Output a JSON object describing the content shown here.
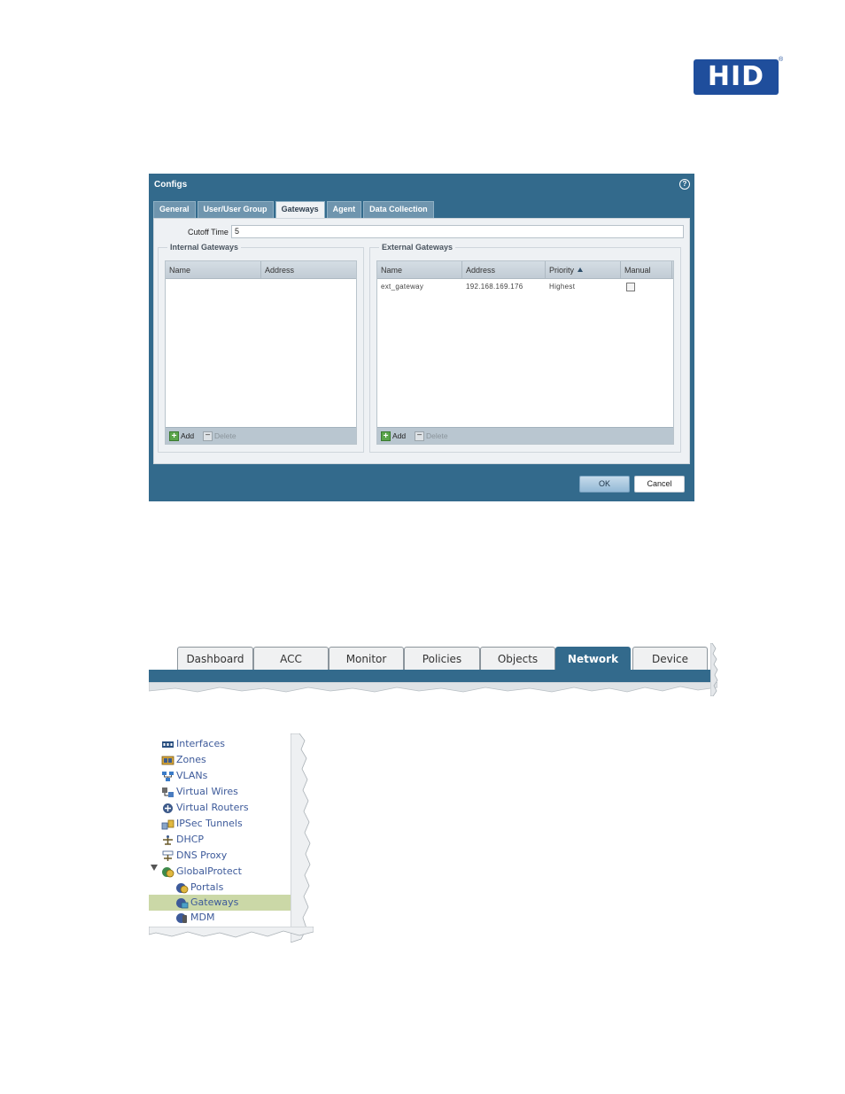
{
  "logo": {
    "text": "HID",
    "registered": "®"
  },
  "dialog": {
    "title": "Configs",
    "tabs": [
      {
        "label": "General",
        "active": false
      },
      {
        "label": "User/User Group",
        "active": false
      },
      {
        "label": "Gateways",
        "active": true
      },
      {
        "label": "Agent",
        "active": false
      },
      {
        "label": "Data Collection",
        "active": false
      }
    ],
    "cutoff_time_label": "Cutoff Time",
    "cutoff_time_value": "5",
    "internal_gateways": {
      "legend": "Internal Gateways",
      "columns": [
        "Name",
        "Address"
      ],
      "rows": [],
      "add_label": "Add",
      "delete_label": "Delete"
    },
    "external_gateways": {
      "legend": "External Gateways",
      "columns": [
        "Name",
        "Address",
        "Priority",
        "Manual"
      ],
      "rows": [
        {
          "name": "ext_gateway",
          "address": "192.168.169.176",
          "priority": "Highest",
          "manual": false
        }
      ],
      "add_label": "Add",
      "delete_label": "Delete"
    },
    "ok_label": "OK",
    "cancel_label": "Cancel"
  },
  "main_tabs": [
    {
      "label": "Dashboard",
      "active": false
    },
    {
      "label": "ACC",
      "active": false
    },
    {
      "label": "Monitor",
      "active": false
    },
    {
      "label": "Policies",
      "active": false
    },
    {
      "label": "Objects",
      "active": false
    },
    {
      "label": "Network",
      "active": true
    },
    {
      "label": "Device",
      "active": false
    }
  ],
  "network_tree": [
    {
      "label": "Interfaces",
      "icon": "interfaces-icon",
      "level": 0
    },
    {
      "label": "Zones",
      "icon": "zones-icon",
      "level": 0
    },
    {
      "label": "VLANs",
      "icon": "vlans-icon",
      "level": 0
    },
    {
      "label": "Virtual Wires",
      "icon": "virtual-wires-icon",
      "level": 0
    },
    {
      "label": "Virtual Routers",
      "icon": "virtual-routers-icon",
      "level": 0
    },
    {
      "label": "IPSec Tunnels",
      "icon": "ipsec-tunnels-icon",
      "level": 0
    },
    {
      "label": "DHCP",
      "icon": "dhcp-icon",
      "level": 0
    },
    {
      "label": "DNS Proxy",
      "icon": "dns-proxy-icon",
      "level": 0
    },
    {
      "label": "GlobalProtect",
      "icon": "globalprotect-icon",
      "level": 0,
      "expanded": true
    },
    {
      "label": "Portals",
      "icon": "portals-icon",
      "level": 1
    },
    {
      "label": "Gateways",
      "icon": "gateways-icon",
      "level": 1,
      "selected": true
    },
    {
      "label": "MDM",
      "icon": "mdm-icon",
      "level": 1
    }
  ],
  "colors": {
    "panos_blue": "#336a8c",
    "hid_blue": "#1f4e9c",
    "tree_selected": "#cbd8a7",
    "tree_text": "#3d5a9a"
  }
}
